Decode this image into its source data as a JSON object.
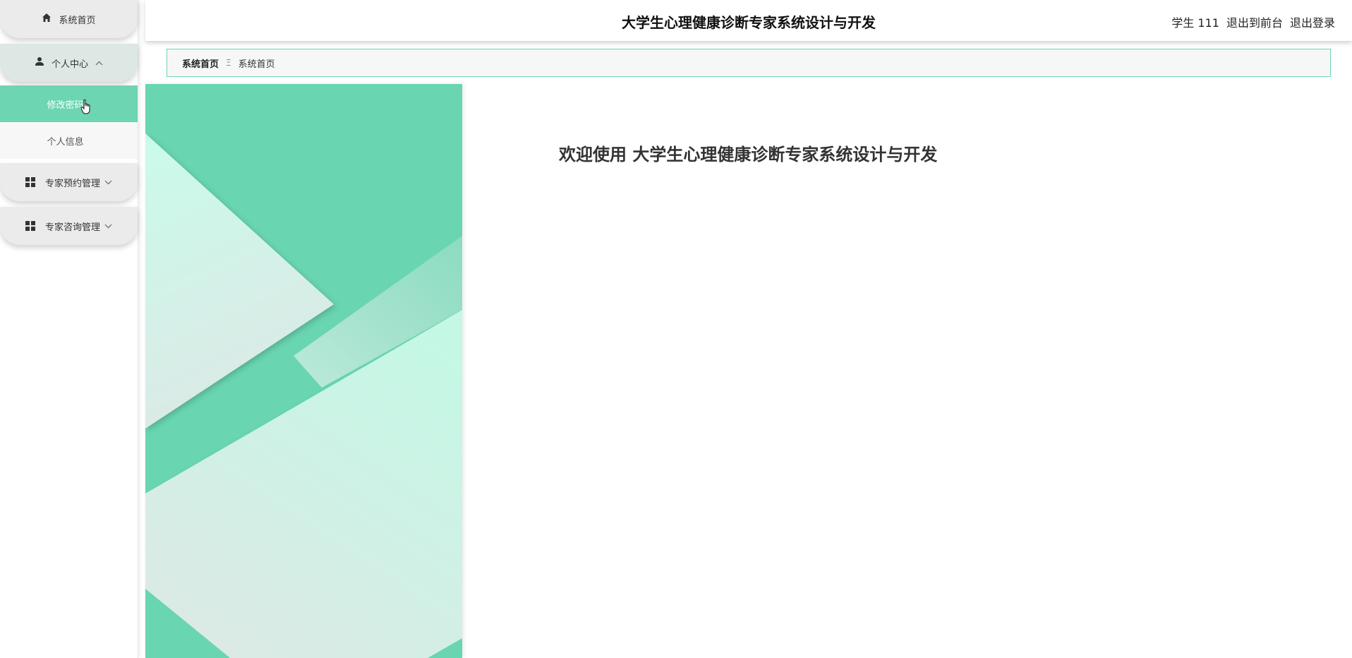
{
  "sidebar": {
    "home": {
      "label": "系统首页",
      "icon": "home-icon"
    },
    "personal_center": {
      "label": "个人中心",
      "icon": "user-icon",
      "items": [
        {
          "label": "修改密码"
        },
        {
          "label": "个人信息"
        }
      ]
    },
    "expert_appointment": {
      "label": "专家预约管理",
      "icon": "grid-icon"
    },
    "expert_consult": {
      "label": "专家咨询管理",
      "icon": "grid-icon"
    }
  },
  "header": {
    "title": "大学生心理健康诊断专家系统设计与开发",
    "user_label": "学生 111",
    "exit_front": "退出到前台",
    "logout": "退出登录"
  },
  "breadcrumb": {
    "home": "系统首页",
    "separator": "Ξ",
    "current": "系统首页"
  },
  "main": {
    "welcome": "欢迎使用 大学生心理健康诊断专家系统设计与开发"
  },
  "colors": {
    "accent": "#6dd5b2",
    "menu_bg": "#ebebeb"
  }
}
